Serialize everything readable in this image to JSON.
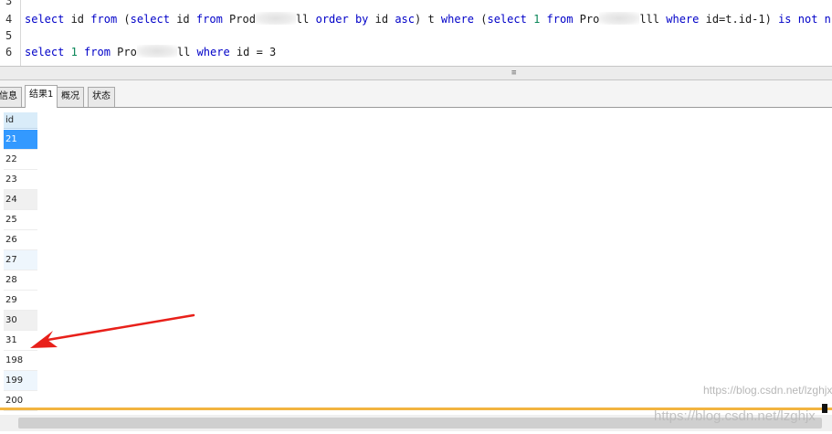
{
  "editor": {
    "line_numbers": [
      "3",
      "4",
      "5",
      "6"
    ],
    "line4": {
      "t1": "select",
      "t2": " id ",
      "t3": "from",
      "t4": " (",
      "t5": "select",
      "t6": " id ",
      "t7": "from",
      "t8": " Prod",
      "t9": "ll ",
      "t10": "order by",
      "t11": " id ",
      "t12": "asc",
      "t13": ") t ",
      "t14": "where",
      "t15": " (",
      "t16": "select",
      "t17": " 1 ",
      "t18": "from",
      "t19": " Pro",
      "t20": "lll ",
      "t21": "where",
      "t22": " id=t.id-1) ",
      "t23": "is not null"
    },
    "line6": {
      "t1": "select",
      "t2": " 1 ",
      "t3": "from",
      "t4": " Pro",
      "t5": "ll ",
      "t6": "where",
      "t7": " id = 3"
    },
    "splitter_grip": "≡"
  },
  "tabs": [
    "信息",
    "结果1",
    "概况",
    "状态"
  ],
  "grid": {
    "column": "id",
    "rows": [
      "21",
      "22",
      "23",
      "24",
      "25",
      "26",
      "27",
      "28",
      "29",
      "30",
      "31",
      "198",
      "199",
      "200"
    ]
  },
  "watermark": {
    "line1": "https://blog.csdn.net/lzghjx",
    "line2": "https://blog.csdn.net/lzghjx"
  },
  "colors": {
    "keyword": "#0000c8",
    "number": "#098658",
    "selected_row": "#3399ff",
    "arrow": "#e8201a"
  }
}
